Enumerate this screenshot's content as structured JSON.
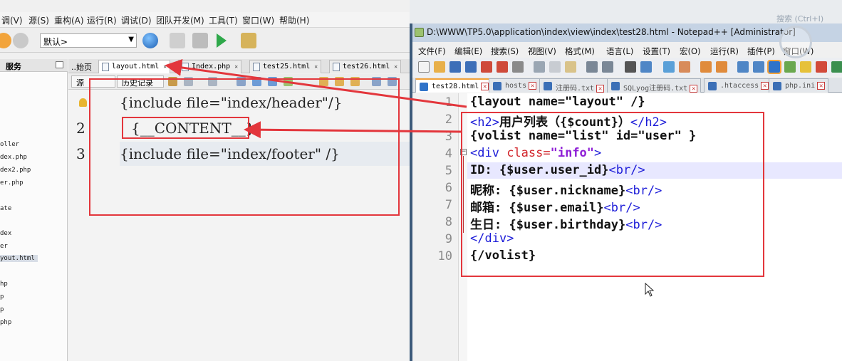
{
  "ide": {
    "menu": [
      "调(V)",
      "源(S)",
      "重构(A)",
      "运行(R)",
      "调试(D)",
      "团队开发(M)",
      "工具(T)",
      "窗口(W)",
      "帮助(H)"
    ],
    "combo_value": "默认>",
    "files_panel_title": "服务",
    "files": [
      "oller",
      "dex.php",
      "dex2.php",
      "er.php",
      "ate",
      "dex",
      "er",
      "yout.html",
      "hp",
      "p",
      "p",
      "php"
    ],
    "tab_start": "..始页",
    "tabs": [
      "layout.html",
      "Index.php",
      "test25.html",
      "test26.html"
    ],
    "toolbar_buttons": [
      "源",
      "历史记录"
    ],
    "code_lines": [
      {
        "num": "",
        "text": "{include file=\"index/header\"/}"
      },
      {
        "num": "2",
        "text": "{__CONTENT__}"
      },
      {
        "num": "3",
        "text": "{include file=\"index/footer\" /}"
      }
    ]
  },
  "npp": {
    "title": "D:\\WWW\\TP5.0\\application\\index\\view\\index\\test28.html - Notepad++ [Administrator]",
    "menu": [
      "文件(F)",
      "编辑(E)",
      "搜索(S)",
      "视图(V)",
      "格式(M)",
      "语言(L)",
      "设置(T)",
      "宏(O)",
      "运行(R)",
      "插件(P)",
      "窗口(W)"
    ],
    "tabs": [
      "test28.html",
      "hosts",
      "注册码.txt",
      "SQLyog注册码.txt",
      ".htaccess",
      "php.ini"
    ],
    "line_numbers": [
      "1",
      "2",
      "3",
      "4",
      "5",
      "6",
      "7",
      "8",
      "9",
      "10"
    ],
    "lines": [
      {
        "plain": "{layout name=\"layout\" /}"
      },
      {
        "tag_open": "<h2>",
        "plain": "用户列表（{$count}）",
        "tag_close": "</h2>"
      },
      {
        "plain": "{volist name=\"list\" id=\"user\" }"
      },
      {
        "tag_open": "<div ",
        "attr": "class=",
        "value": "\"info\"",
        "tag_close": ">"
      },
      {
        "plain": "ID: {$user.user_id}",
        "tag_close": "<br/>"
      },
      {
        "plain": "昵称: {$user.nickname}",
        "tag_close": "<br/>"
      },
      {
        "plain": "邮箱: {$user.email}",
        "tag_close": "<br/>"
      },
      {
        "plain": "生日: {$user.birthday}",
        "tag_close": "<br/>"
      },
      {
        "tag_close": "</div>"
      },
      {
        "plain": "{/volist}"
      }
    ]
  },
  "watermark": "搜索 (Ctrl+I)",
  "colors": {
    "annotation": "#e3363c",
    "tag": "#1c1cd8",
    "attr": "#d2252b",
    "value": "#8e1ed6"
  }
}
